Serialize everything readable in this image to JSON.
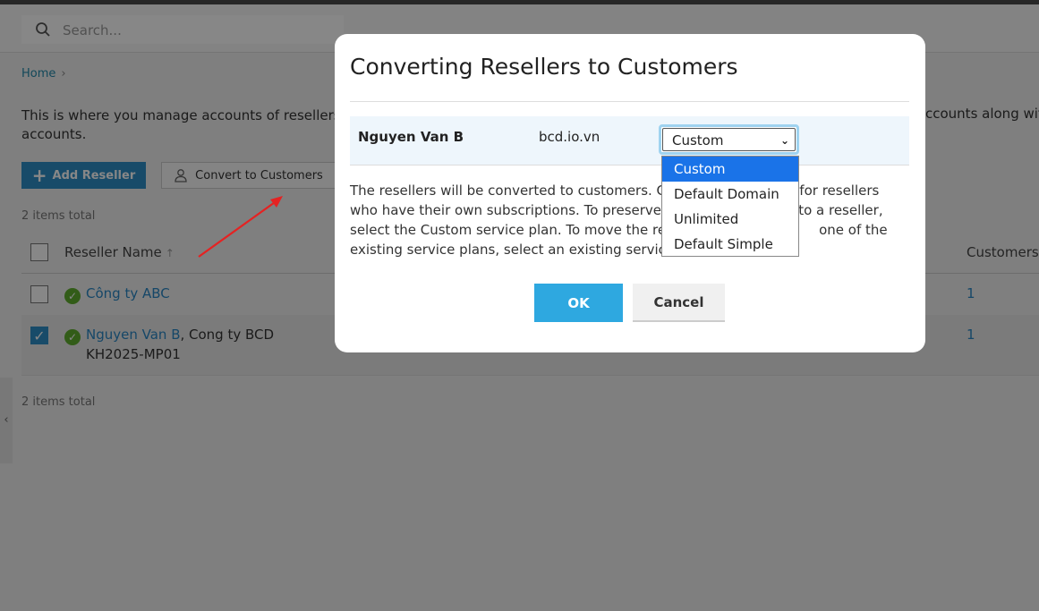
{
  "search": {
    "placeholder": "Search..."
  },
  "breadcrumb": {
    "home": "Home"
  },
  "page": {
    "description_left": "This is where you manage accounts of resellers –",
    "description_right": "ccounts along with",
    "description_line2": "accounts."
  },
  "toolbar": {
    "add_label": "Add Reseller",
    "convert_label": "Convert to Customers"
  },
  "items_total_top": "2 items total",
  "items_total_bottom": "2 items total",
  "table": {
    "col_name": "Reseller Name",
    "col_customers": "Customers",
    "rows": [
      {
        "name": "Công ty ABC",
        "company": "",
        "sub": "",
        "customers": "1",
        "checked": false
      },
      {
        "name": "Nguyen Van B",
        "company": ", Cong ty BCD",
        "sub": "KH2025-MP01",
        "customers": "1",
        "checked": true
      }
    ]
  },
  "modal": {
    "title": "Converting Resellers to Customers",
    "row": {
      "name": "Nguyen Van B",
      "domain": "bcd.io.vn",
      "selected_plan": "Custom"
    },
    "body": [
      "The resellers will be converted to customers. Cho",
      "s for resellers",
      "who have their own subscriptions. To preserve th",
      "e to a reseller,",
      "select the Custom service plan. To move the rese",
      "one of the",
      "existing service plans, select an existing service p"
    ],
    "ok_label": "OK",
    "cancel_label": "Cancel",
    "plan_options": [
      "Custom",
      "Default Domain",
      "Unlimited",
      "Default Simple"
    ]
  },
  "colors": {
    "accent": "#2f8fc7",
    "ok_button": "#2ea8e0",
    "link": "#2a87c4",
    "status_ok": "#5fae2e",
    "dropdown_active": "#1a73e8"
  }
}
